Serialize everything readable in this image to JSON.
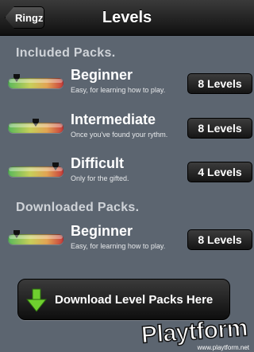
{
  "navbar": {
    "back_label": "Ringz",
    "title": "Levels"
  },
  "sections": {
    "included": "Included Packs.",
    "downloaded": "Downloaded Packs."
  },
  "packs": [
    {
      "name": "Beginner",
      "description": "Easy, for learning how to play.",
      "count": "8 Levels",
      "difficulty": 0.15
    },
    {
      "name": "Intermediate",
      "description": "Once you've found your rythm.",
      "count": "8 Levels",
      "difficulty": 0.5
    },
    {
      "name": "Difficult",
      "description": "Only for the gifted.",
      "count": "4 Levels",
      "difficulty": 0.85
    },
    {
      "name": "Beginner",
      "description": "Easy, for learning how to play.",
      "count": "8 Levels",
      "difficulty": 0.15
    }
  ],
  "download": {
    "label": "Download  Level Packs Here"
  },
  "watermark": {
    "brand": "Playtform",
    "url": "www.playtform.net"
  },
  "icons": {
    "back": "back-arrow-icon",
    "difficulty_marker": "marker-pin-icon",
    "download": "green-down-arrow-icon"
  },
  "colors": {
    "background": "#5c6570",
    "button": "#1e1e1e",
    "download_arrow": "#6fcf2f",
    "difficulty_low": "#58b85b",
    "difficulty_high": "#c73b3b"
  }
}
